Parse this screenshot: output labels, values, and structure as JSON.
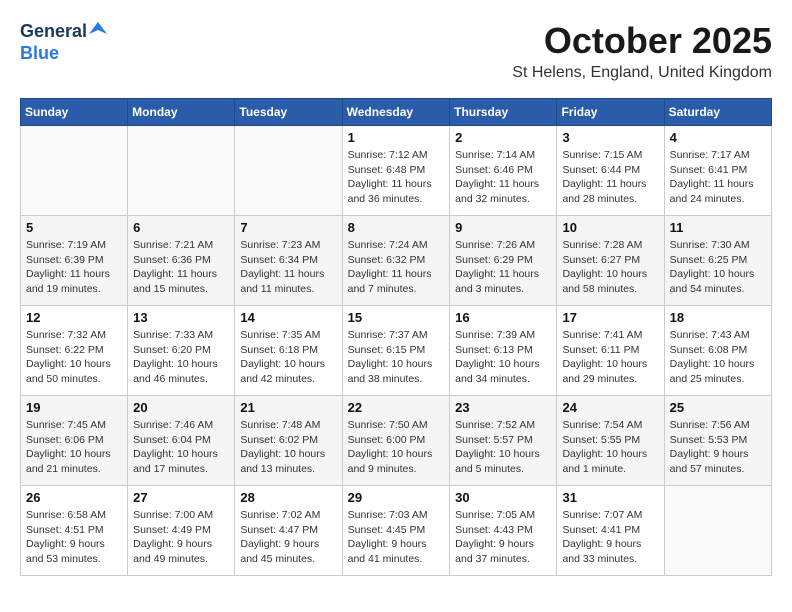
{
  "header": {
    "logo_general": "General",
    "logo_blue": "Blue",
    "month": "October 2025",
    "location": "St Helens, England, United Kingdom"
  },
  "weekdays": [
    "Sunday",
    "Monday",
    "Tuesday",
    "Wednesday",
    "Thursday",
    "Friday",
    "Saturday"
  ],
  "weeks": [
    [
      {
        "day": "",
        "info": ""
      },
      {
        "day": "",
        "info": ""
      },
      {
        "day": "",
        "info": ""
      },
      {
        "day": "1",
        "info": "Sunrise: 7:12 AM\nSunset: 6:48 PM\nDaylight: 11 hours\nand 36 minutes."
      },
      {
        "day": "2",
        "info": "Sunrise: 7:14 AM\nSunset: 6:46 PM\nDaylight: 11 hours\nand 32 minutes."
      },
      {
        "day": "3",
        "info": "Sunrise: 7:15 AM\nSunset: 6:44 PM\nDaylight: 11 hours\nand 28 minutes."
      },
      {
        "day": "4",
        "info": "Sunrise: 7:17 AM\nSunset: 6:41 PM\nDaylight: 11 hours\nand 24 minutes."
      }
    ],
    [
      {
        "day": "5",
        "info": "Sunrise: 7:19 AM\nSunset: 6:39 PM\nDaylight: 11 hours\nand 19 minutes."
      },
      {
        "day": "6",
        "info": "Sunrise: 7:21 AM\nSunset: 6:36 PM\nDaylight: 11 hours\nand 15 minutes."
      },
      {
        "day": "7",
        "info": "Sunrise: 7:23 AM\nSunset: 6:34 PM\nDaylight: 11 hours\nand 11 minutes."
      },
      {
        "day": "8",
        "info": "Sunrise: 7:24 AM\nSunset: 6:32 PM\nDaylight: 11 hours\nand 7 minutes."
      },
      {
        "day": "9",
        "info": "Sunrise: 7:26 AM\nSunset: 6:29 PM\nDaylight: 11 hours\nand 3 minutes."
      },
      {
        "day": "10",
        "info": "Sunrise: 7:28 AM\nSunset: 6:27 PM\nDaylight: 10 hours\nand 58 minutes."
      },
      {
        "day": "11",
        "info": "Sunrise: 7:30 AM\nSunset: 6:25 PM\nDaylight: 10 hours\nand 54 minutes."
      }
    ],
    [
      {
        "day": "12",
        "info": "Sunrise: 7:32 AM\nSunset: 6:22 PM\nDaylight: 10 hours\nand 50 minutes."
      },
      {
        "day": "13",
        "info": "Sunrise: 7:33 AM\nSunset: 6:20 PM\nDaylight: 10 hours\nand 46 minutes."
      },
      {
        "day": "14",
        "info": "Sunrise: 7:35 AM\nSunset: 6:18 PM\nDaylight: 10 hours\nand 42 minutes."
      },
      {
        "day": "15",
        "info": "Sunrise: 7:37 AM\nSunset: 6:15 PM\nDaylight: 10 hours\nand 38 minutes."
      },
      {
        "day": "16",
        "info": "Sunrise: 7:39 AM\nSunset: 6:13 PM\nDaylight: 10 hours\nand 34 minutes."
      },
      {
        "day": "17",
        "info": "Sunrise: 7:41 AM\nSunset: 6:11 PM\nDaylight: 10 hours\nand 29 minutes."
      },
      {
        "day": "18",
        "info": "Sunrise: 7:43 AM\nSunset: 6:08 PM\nDaylight: 10 hours\nand 25 minutes."
      }
    ],
    [
      {
        "day": "19",
        "info": "Sunrise: 7:45 AM\nSunset: 6:06 PM\nDaylight: 10 hours\nand 21 minutes."
      },
      {
        "day": "20",
        "info": "Sunrise: 7:46 AM\nSunset: 6:04 PM\nDaylight: 10 hours\nand 17 minutes."
      },
      {
        "day": "21",
        "info": "Sunrise: 7:48 AM\nSunset: 6:02 PM\nDaylight: 10 hours\nand 13 minutes."
      },
      {
        "day": "22",
        "info": "Sunrise: 7:50 AM\nSunset: 6:00 PM\nDaylight: 10 hours\nand 9 minutes."
      },
      {
        "day": "23",
        "info": "Sunrise: 7:52 AM\nSunset: 5:57 PM\nDaylight: 10 hours\nand 5 minutes."
      },
      {
        "day": "24",
        "info": "Sunrise: 7:54 AM\nSunset: 5:55 PM\nDaylight: 10 hours\nand 1 minute."
      },
      {
        "day": "25",
        "info": "Sunrise: 7:56 AM\nSunset: 5:53 PM\nDaylight: 9 hours\nand 57 minutes."
      }
    ],
    [
      {
        "day": "26",
        "info": "Sunrise: 6:58 AM\nSunset: 4:51 PM\nDaylight: 9 hours\nand 53 minutes."
      },
      {
        "day": "27",
        "info": "Sunrise: 7:00 AM\nSunset: 4:49 PM\nDaylight: 9 hours\nand 49 minutes."
      },
      {
        "day": "28",
        "info": "Sunrise: 7:02 AM\nSunset: 4:47 PM\nDaylight: 9 hours\nand 45 minutes."
      },
      {
        "day": "29",
        "info": "Sunrise: 7:03 AM\nSunset: 4:45 PM\nDaylight: 9 hours\nand 41 minutes."
      },
      {
        "day": "30",
        "info": "Sunrise: 7:05 AM\nSunset: 4:43 PM\nDaylight: 9 hours\nand 37 minutes."
      },
      {
        "day": "31",
        "info": "Sunrise: 7:07 AM\nSunset: 4:41 PM\nDaylight: 9 hours\nand 33 minutes."
      },
      {
        "day": "",
        "info": ""
      }
    ]
  ]
}
